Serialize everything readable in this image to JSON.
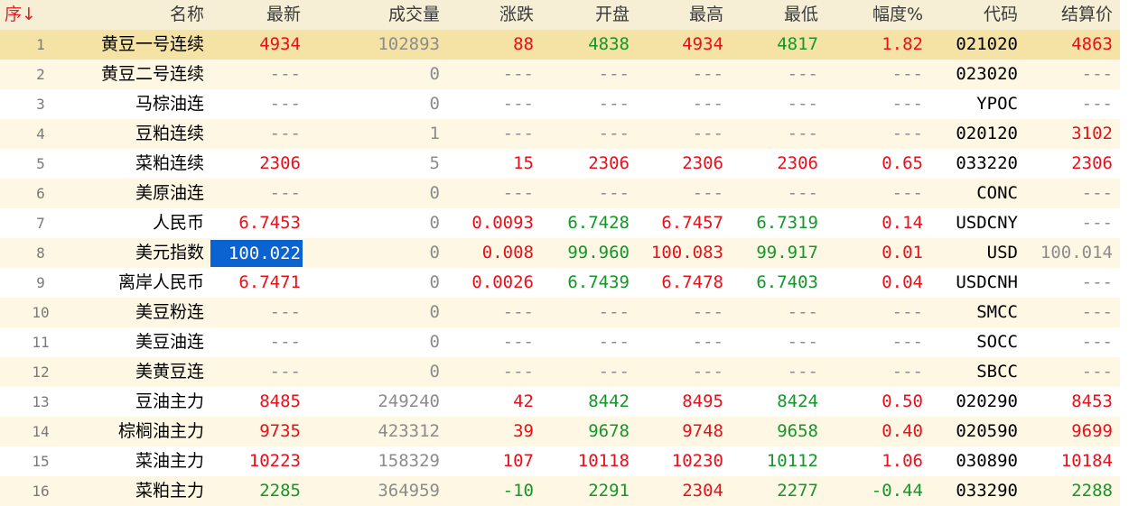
{
  "colors": {
    "rise": "#e8101a",
    "fall": "#14962a",
    "unchanged": "#8c8c8c",
    "text": "#000000",
    "header_text": "#3a3a3a",
    "sort_accent": "#d8222a",
    "row_number": "#7a7a7a",
    "header_bg": "#f6efd6",
    "selected_row_bg": "#f4e3a5",
    "alt_row_bg": "#fdf7e4",
    "row_bg": "#ffffff",
    "focus_cell_bg": "#0b63d1",
    "focus_cell_text": "#ffffff"
  },
  "header": {
    "seq": "序",
    "sort_indicator": "↓",
    "name": "名称",
    "last": "最新",
    "volume": "成交量",
    "change": "涨跌",
    "open": "开盘",
    "high": "最高",
    "low": "最低",
    "range_pct": "幅度%",
    "code": "代码",
    "settle": "结算价"
  },
  "rows": [
    {
      "seq": "1",
      "name": "黄豆一号连续",
      "last": "4934",
      "volume": "102893",
      "change": "88",
      "open": "4838",
      "high": "4934",
      "low": "4817",
      "range_pct": "1.82",
      "code": "021020",
      "settle": "4863"
    },
    {
      "seq": "2",
      "name": "黄豆二号连续",
      "last": "---",
      "volume": "0",
      "change": "---",
      "open": "---",
      "high": "---",
      "low": "---",
      "range_pct": "---",
      "code": "023020",
      "settle": "---"
    },
    {
      "seq": "3",
      "name": "马棕油连",
      "last": "---",
      "volume": "0",
      "change": "---",
      "open": "---",
      "high": "---",
      "low": "---",
      "range_pct": "---",
      "code": "YPOC",
      "settle": "---"
    },
    {
      "seq": "4",
      "name": "豆粕连续",
      "last": "---",
      "volume": "1",
      "change": "---",
      "open": "---",
      "high": "---",
      "low": "---",
      "range_pct": "---",
      "code": "020120",
      "settle": "3102"
    },
    {
      "seq": "5",
      "name": "菜粕连续",
      "last": "2306",
      "volume": "5",
      "change": "15",
      "open": "2306",
      "high": "2306",
      "low": "2306",
      "range_pct": "0.65",
      "code": "033220",
      "settle": "2306"
    },
    {
      "seq": "6",
      "name": "美原油连",
      "last": "---",
      "volume": "0",
      "change": "---",
      "open": "---",
      "high": "---",
      "low": "---",
      "range_pct": "---",
      "code": "CONC",
      "settle": "---"
    },
    {
      "seq": "7",
      "name": "人民币",
      "last": "6.7453",
      "volume": "0",
      "change": "0.0093",
      "open": "6.7428",
      "high": "6.7457",
      "low": "6.7319",
      "range_pct": "0.14",
      "code": "USDCNY",
      "settle": "---"
    },
    {
      "seq": "8",
      "name": "美元指数",
      "last": "100.022",
      "volume": "0",
      "change": "0.008",
      "open": "99.960",
      "high": "100.083",
      "low": "99.917",
      "range_pct": "0.01",
      "code": "USD",
      "settle": "100.014"
    },
    {
      "seq": "9",
      "name": "离岸人民币",
      "last": "6.7471",
      "volume": "0",
      "change": "0.0026",
      "open": "6.7439",
      "high": "6.7478",
      "low": "6.7403",
      "range_pct": "0.04",
      "code": "USDCNH",
      "settle": "---"
    },
    {
      "seq": "10",
      "name": "美豆粉连",
      "last": "---",
      "volume": "0",
      "change": "---",
      "open": "---",
      "high": "---",
      "low": "---",
      "range_pct": "---",
      "code": "SMCC",
      "settle": "---"
    },
    {
      "seq": "11",
      "name": "美豆油连",
      "last": "---",
      "volume": "0",
      "change": "---",
      "open": "---",
      "high": "---",
      "low": "---",
      "range_pct": "---",
      "code": "SOCC",
      "settle": "---"
    },
    {
      "seq": "12",
      "name": "美黄豆连",
      "last": "---",
      "volume": "0",
      "change": "---",
      "open": "---",
      "high": "---",
      "low": "---",
      "range_pct": "---",
      "code": "SBCC",
      "settle": "---"
    },
    {
      "seq": "13",
      "name": "豆油主力",
      "last": "8485",
      "volume": "249240",
      "change": "42",
      "open": "8442",
      "high": "8495",
      "low": "8424",
      "range_pct": "0.50",
      "code": "020290",
      "settle": "8453"
    },
    {
      "seq": "14",
      "name": "棕榈油主力",
      "last": "9735",
      "volume": "423312",
      "change": "39",
      "open": "9678",
      "high": "9748",
      "low": "9658",
      "range_pct": "0.40",
      "code": "020590",
      "settle": "9699"
    },
    {
      "seq": "15",
      "name": "菜油主力",
      "last": "10223",
      "volume": "158329",
      "change": "107",
      "open": "10118",
      "high": "10230",
      "low": "10112",
      "range_pct": "1.06",
      "code": "030890",
      "settle": "10184"
    },
    {
      "seq": "16",
      "name": "菜粕主力",
      "last": "2285",
      "volume": "364959",
      "change": "-10",
      "open": "2291",
      "high": "2304",
      "low": "2277",
      "range_pct": "-0.44",
      "code": "033290",
      "settle": "2288"
    }
  ]
}
